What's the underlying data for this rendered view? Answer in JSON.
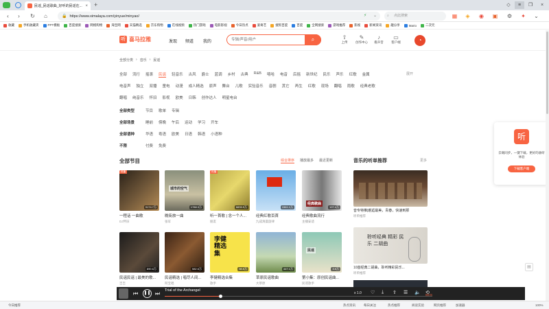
{
  "browser": {
    "tab_title": "民谣_民谣歌曲_好听的民谣在...",
    "url": "https://www.ximalaya.com/yinyue/minyao/",
    "search_placeholder": "点此搜索",
    "bookmarks": [
      "收藏",
      "手机收藏夹",
      "PPT模板",
      "百度搜索",
      "网络购物",
      "海宝网",
      "天猫精选",
      "京东购物",
      "在线视频",
      "热门游戏",
      "电影影视",
      "今日热点",
      "爱奇艺",
      "搜狗百度",
      "百度",
      "全网搜索",
      "游戏推荐",
      "影视",
      "新闻资讯",
      "趣分享",
      "Mario",
      "二次元"
    ]
  },
  "site": {
    "logo_text": "喜马拉雅",
    "nav": [
      "发现",
      "频道",
      "我的"
    ],
    "search_placeholder": "专辑/声音/用户",
    "tools": [
      "上传",
      "创作中心",
      "看声音",
      "客户端"
    ]
  },
  "breadcrumb": [
    "全部分类",
    "音乐",
    "民谣"
  ],
  "filters": {
    "row1": [
      "全部",
      "流行",
      "摇滚",
      "民谣",
      "轻音乐",
      "古风",
      "爵士",
      "蓝调",
      "乡村",
      "古典",
      "R&B",
      "嘻哈",
      "电音",
      "后摇",
      "新世纪",
      "民乐",
      "声乐",
      "红歌",
      "金属"
    ],
    "row2": [
      "电音声",
      "独立",
      "双播",
      "童电",
      "动漫",
      "成人精选",
      "原声",
      "舞台",
      "儿歌",
      "实验音乐",
      "音剧",
      "其它",
      "再生",
      "红歌",
      "现场",
      "翻唱",
      "雨歌",
      "经典老歌"
    ],
    "row3": [
      "翻唱",
      "纯音乐",
      "怀旧",
      "影视",
      "欧美",
      "日韩",
      "创作达人",
      "明星电台"
    ],
    "mood_label": "全部类型",
    "mood": [
      "节目",
      "歌单",
      "专辑"
    ],
    "scene_label": "全部场景",
    "scene": [
      "睡前",
      "傍晚",
      "午后",
      "运动",
      "学习",
      "开车"
    ],
    "lang_label": "全部语种",
    "lang": [
      "华语",
      "粤语",
      "欧美",
      "日语",
      "韩语",
      "小语种"
    ],
    "paid_label": "不限",
    "paid": [
      "付费",
      "免费"
    ],
    "more": "展开"
  },
  "programs": {
    "title": "全部节目",
    "sort": [
      "综合排序",
      "播放最多",
      "最近更新"
    ],
    "items": [
      {
        "title": "一程话 一曲歌",
        "author": "DJ怀旧",
        "plays": "9174.7万",
        "tag": "热播"
      },
      {
        "title": "晚街旅一曲",
        "author": "张军",
        "plays": "1788.3万",
        "tag": ""
      },
      {
        "title": "听一首歌 | 念一个人...",
        "author": "朋友",
        "plays": "6835.9万",
        "tag": "热播"
      },
      {
        "title": "经典红歌百首",
        "author": "九成清晨旋律",
        "plays": "1561.1万",
        "tag": ""
      },
      {
        "title": "经典歌曲流行",
        "author": "主播安适",
        "plays": "107.4万",
        "tag": ""
      },
      {
        "title": "民谣民谣 | 最美的歌...",
        "author": "吉吉",
        "plays": "890.6万",
        "tag": ""
      },
      {
        "title": "民谣精选 | 唱尽人间...",
        "author": "阿宝唱",
        "plays": "582.6万",
        "tag": ""
      },
      {
        "title": "李健精选合集",
        "author": "歌手",
        "plays": "98.5万",
        "tag": ""
      },
      {
        "title": "草原民谣歌曲",
        "author": "大草原",
        "plays": "447.1万",
        "tag": ""
      },
      {
        "title": "第小集：原创民谣曲...",
        "author": "民谣歌手",
        "plays": "3.5万",
        "tag": ""
      }
    ],
    "cover_texts": {
      "card2": "城市的空气",
      "card5": "经典歌曲",
      "card8": [
        "李健",
        "精选",
        "集"
      ],
      "card10": "民谣"
    }
  },
  "recommend": {
    "title": "音乐的听单推荐",
    "more": "更多",
    "items": [
      {
        "title": "音专特推|邂逅最美，青春，快速到那",
        "meta": "听单推荐"
      },
      {
        "title": "10首经典二胡曲，聆听精彩民乐...",
        "meta": "听单推荐",
        "img_text": "聆听经典 精彩 民乐 二胡曲"
      }
    ]
  },
  "promo": {
    "text": "云端同步，一键下载，更好的收听体验",
    "button": "下载客户端"
  },
  "player": {
    "track": "Trial of the Archangel",
    "time": "00:01:55 / 00:02:55",
    "progress": 0.2
  },
  "statusbar": {
    "left": "今日推荐",
    "items": [
      "热点资讯",
      "每日关注",
      "热点推荐",
      "阅读实验",
      "网页推荐",
      "加速器"
    ],
    "zoom": "100%"
  },
  "colors": {
    "brand": "#f86442"
  }
}
